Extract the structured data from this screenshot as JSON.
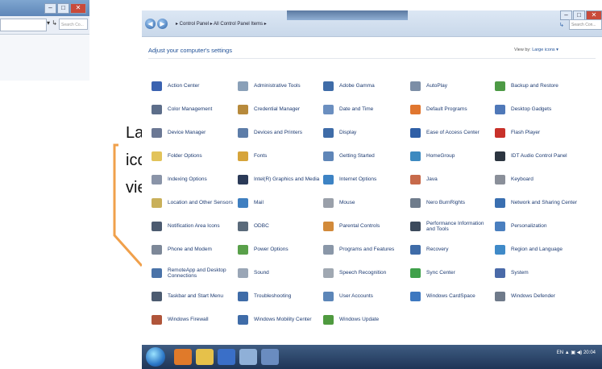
{
  "annotation": {
    "lines": [
      "Large",
      "icons",
      "view"
    ],
    "bracket_color": "#f0a04b"
  },
  "left_window": {
    "search_placeholder": "Search Co...",
    "dropdown_glyph": "▾ ↳"
  },
  "window": {
    "controls": {
      "minimize": "–",
      "maximize": "□",
      "close": "✕"
    },
    "breadcrumb": "▸ Control Panel ▸ All Control Panel Items ▸",
    "search_placeholder": "Search Con...",
    "refresh_glyph": "↳",
    "heading": "Adjust your computer's settings",
    "view_by_label": "View by:",
    "view_by_value": "Large icons ▾"
  },
  "items": [
    {
      "label": "Action Center",
      "icon": "flag-icon",
      "color": "#3a62b0"
    },
    {
      "label": "Administrative Tools",
      "icon": "admin-tools-icon",
      "color": "#8aa0b8"
    },
    {
      "label": "Adobe Gamma",
      "icon": "monitor-icon",
      "color": "#3f6ca8"
    },
    {
      "label": "AutoPlay",
      "icon": "autoplay-icon",
      "color": "#7c8ea6"
    },
    {
      "label": "Backup and Restore",
      "icon": "backup-icon",
      "color": "#4d9a45"
    },
    {
      "label": "Color Management",
      "icon": "color-icon",
      "color": "#5d6e8a"
    },
    {
      "label": "Credential Manager",
      "icon": "credential-icon",
      "color": "#b78a3c"
    },
    {
      "label": "Date and Time",
      "icon": "clock-icon",
      "color": "#6b8fc0"
    },
    {
      "label": "Default Programs",
      "icon": "default-programs-icon",
      "color": "#e0762f"
    },
    {
      "label": "Desktop Gadgets",
      "icon": "gadgets-icon",
      "color": "#4f78b8"
    },
    {
      "label": "Device Manager",
      "icon": "device-manager-icon",
      "color": "#6b7894"
    },
    {
      "label": "Devices and Printers",
      "icon": "printer-icon",
      "color": "#5d7da8"
    },
    {
      "label": "Display",
      "icon": "display-icon",
      "color": "#3f6ca8"
    },
    {
      "label": "Ease of Access Center",
      "icon": "ease-access-icon",
      "color": "#2f5fa6"
    },
    {
      "label": "Flash Player",
      "icon": "flash-icon",
      "color": "#c8312a"
    },
    {
      "label": "Folder Options",
      "icon": "folder-icon",
      "color": "#e2c35a"
    },
    {
      "label": "Fonts",
      "icon": "fonts-icon",
      "color": "#d6a43a"
    },
    {
      "label": "Getting Started",
      "icon": "getting-started-icon",
      "color": "#5f86b8"
    },
    {
      "label": "HomeGroup",
      "icon": "homegroup-icon",
      "color": "#3d8ac0"
    },
    {
      "label": "IDT Audio Control Panel",
      "icon": "audio-icon",
      "color": "#2c3540"
    },
    {
      "label": "Indexing Options",
      "icon": "indexing-icon",
      "color": "#8a94a8"
    },
    {
      "label": "Intel(R) Graphics and Media",
      "icon": "intel-icon",
      "color": "#2b3a58"
    },
    {
      "label": "Internet Options",
      "icon": "internet-icon",
      "color": "#3d83c4"
    },
    {
      "label": "Java",
      "icon": "java-icon",
      "color": "#c76a4a"
    },
    {
      "label": "Keyboard",
      "icon": "keyboard-icon",
      "color": "#8a8f99"
    },
    {
      "label": "Location and Other Sensors",
      "icon": "location-icon",
      "color": "#c9b05a"
    },
    {
      "label": "Mail",
      "icon": "mail-icon",
      "color": "#3f7fc0"
    },
    {
      "label": "Mouse",
      "icon": "mouse-icon",
      "color": "#9aa0aa"
    },
    {
      "label": "Nero BurnRights",
      "icon": "nero-icon",
      "color": "#6f7c8c"
    },
    {
      "label": "Network and Sharing Center",
      "icon": "network-icon",
      "color": "#3a6fb0"
    },
    {
      "label": "Notification Area Icons",
      "icon": "notification-icon",
      "color": "#4c5b70"
    },
    {
      "label": "ODBC",
      "icon": "odbc-icon",
      "color": "#5a6a7a"
    },
    {
      "label": "Parental Controls",
      "icon": "parental-icon",
      "color": "#d28a3a"
    },
    {
      "label": "Performance Information and Tools",
      "icon": "performance-icon",
      "color": "#3c4a5c"
    },
    {
      "label": "Personalization",
      "icon": "personalization-icon",
      "color": "#4a7fbf"
    },
    {
      "label": "Phone and Modem",
      "icon": "phone-icon",
      "color": "#7d8898"
    },
    {
      "label": "Power Options",
      "icon": "power-icon",
      "color": "#59a04a"
    },
    {
      "label": "Programs and Features",
      "icon": "programs-icon",
      "color": "#8a97a8"
    },
    {
      "label": "Recovery",
      "icon": "recovery-icon",
      "color": "#3f6ca8"
    },
    {
      "label": "Region and Language",
      "icon": "region-icon",
      "color": "#3f8ac8"
    },
    {
      "label": "RemoteApp and Desktop Connections",
      "icon": "remoteapp-icon",
      "color": "#4a73a8"
    },
    {
      "label": "Sound",
      "icon": "sound-icon",
      "color": "#9aa6b6"
    },
    {
      "label": "Speech Recognition",
      "icon": "speech-icon",
      "color": "#a0a8b2"
    },
    {
      "label": "Sync Center",
      "icon": "sync-icon",
      "color": "#3fa04a"
    },
    {
      "label": "System",
      "icon": "system-icon",
      "color": "#4a6aa8"
    },
    {
      "label": "Taskbar and Start Menu",
      "icon": "taskbar-icon",
      "color": "#4c5b70"
    },
    {
      "label": "Troubleshooting",
      "icon": "troubleshooting-icon",
      "color": "#3f6ca8"
    },
    {
      "label": "User Accounts",
      "icon": "user-accounts-icon",
      "color": "#5c86b8"
    },
    {
      "label": "Windows CardSpace",
      "icon": "cardspace-icon",
      "color": "#3d78c0"
    },
    {
      "label": "Windows Defender",
      "icon": "defender-icon",
      "color": "#6f7a8a"
    },
    {
      "label": "Windows Firewall",
      "icon": "firewall-icon",
      "color": "#b0553a"
    },
    {
      "label": "Windows Mobility Center",
      "icon": "mobility-icon",
      "color": "#3f6ca8"
    },
    {
      "label": "Windows Update",
      "icon": "update-icon",
      "color": "#4f9a3f"
    }
  ],
  "taskbar": {
    "pinned": [
      {
        "name": "taskbar-media-icon",
        "color": "#e07a2a"
      },
      {
        "name": "taskbar-explorer-icon",
        "color": "#e6c14a"
      },
      {
        "name": "taskbar-word-icon",
        "color": "#3a6fc8"
      },
      {
        "name": "taskbar-paint-icon",
        "color": "#8fb0d8"
      },
      {
        "name": "taskbar-controlpanel-icon",
        "color": "#6a8cc0"
      }
    ],
    "tray_text": "EN  ▲  ▣  ◀)  20:04"
  }
}
